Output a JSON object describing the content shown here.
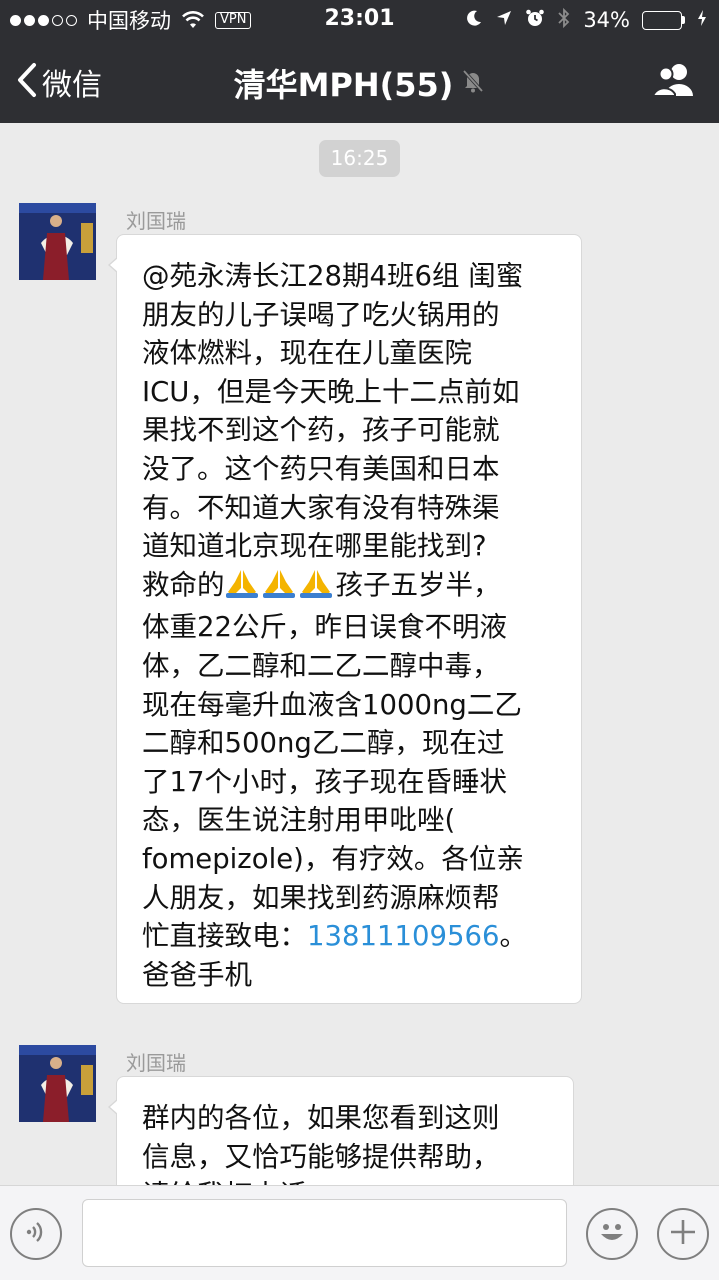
{
  "status_bar": {
    "carrier": "中国移动",
    "vpn": "VPN",
    "time": "23:01",
    "battery_percent": "34%",
    "battery_level": 0.34,
    "battery_color": "#4cd964"
  },
  "nav": {
    "back_label": "微信",
    "title": "清华MPH(55)",
    "icons": [
      "chevron-left-icon",
      "muted-bell-icon",
      "group-members-icon"
    ]
  },
  "chat": {
    "timestamp": "16:25",
    "messages": [
      {
        "sender": "刘国瑞",
        "lines": [
          "@苑永涛长江28期4班6组 闺蜜",
          "朋友的儿子误喝了吃火锅用的",
          "液体燃料，现在在儿童医院",
          "ICU，但是今天晚上十二点前如",
          "果找不到这个药，孩子可能就",
          "没了。这个药只有美国和日本",
          "有。不知道大家有没有特殊渠",
          "道知道北京现在哪里能找到?",
          "救命的",
          "孩子五岁半，",
          "体重22公斤，昨日误食不明液",
          "体，乙二醇和二乙二醇中毒，",
          "现在每毫升血液含1000ng二乙",
          "二醇和500ng乙二醇，现在过",
          "了17个小时，孩子现在昏睡状",
          "态，医生说注射用甲吡唑(",
          "fomepizole)，有疗效。各位亲",
          "人朋友，如果找到药源麻烦帮",
          "忙直接致电：",
          "13811109566",
          "。",
          "爸爸手机"
        ]
      },
      {
        "sender": "刘国瑞",
        "lines": [
          "群内的各位，如果您看到这则",
          "信息，又恰巧能够提供帮助，",
          "请给我打电话"
        ]
      }
    ]
  },
  "input_bar": {
    "icons": [
      "voice-icon",
      "emoji-icon",
      "plus-icon"
    ]
  }
}
